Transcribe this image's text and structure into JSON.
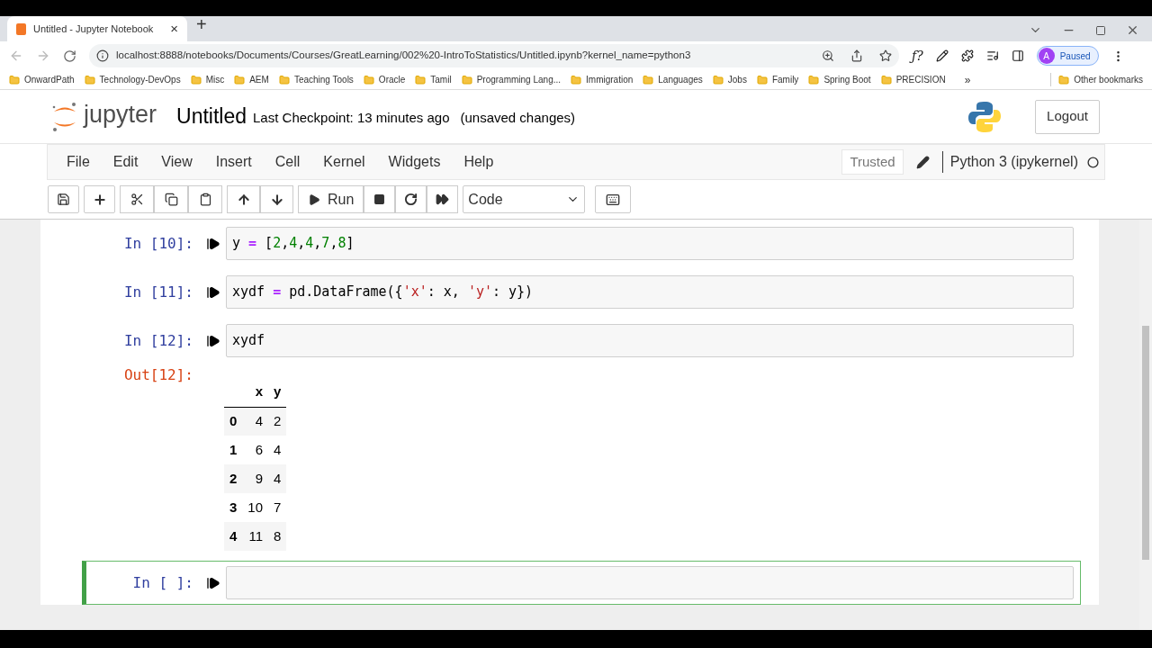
{
  "browser": {
    "tab": {
      "title": "Untitled - Jupyter Notebook",
      "close": "×",
      "new_tab": "+"
    },
    "address": "localhost:8888/notebooks/Documents/Courses/GreatLearning/002%20-IntroToStatistics/Untitled.ipynb?kernel_name=python3",
    "extension_label": "ƒ?",
    "profile": {
      "initial": "A",
      "status": "Paused"
    },
    "bookmarks": [
      "OnwardPath",
      "Technology-DevOps",
      "Misc",
      "AEM",
      "Teaching Tools",
      "Oracle",
      "Tamil",
      "Programming Lang...",
      "Immigration",
      "Languages",
      "Jobs",
      "Family",
      "Spring Boot",
      "PRECISION"
    ],
    "overflow": "»",
    "other_bookmarks": "Other bookmarks"
  },
  "header": {
    "logo_text": "jupyter",
    "notebook_name": "Untitled",
    "checkpoint": "Last Checkpoint: 13 minutes ago",
    "save_status": "(unsaved changes)",
    "logout": "Logout"
  },
  "menu": [
    "File",
    "Edit",
    "View",
    "Insert",
    "Cell",
    "Kernel",
    "Widgets",
    "Help"
  ],
  "trusted": "Trusted",
  "kernel": "Python 3 (ipykernel)",
  "toolbar": {
    "run": "Run",
    "cell_type": "Code"
  },
  "cells": [
    {
      "prompt": "In [10]:",
      "selected": false,
      "code": [
        {
          "kind": "plain",
          "text": "y "
        },
        {
          "kind": "op",
          "text": "="
        },
        {
          "kind": "plain",
          "text": " ["
        },
        {
          "kind": "number",
          "text": "2"
        },
        {
          "kind": "plain",
          "text": ","
        },
        {
          "kind": "number",
          "text": "4"
        },
        {
          "kind": "plain",
          "text": ","
        },
        {
          "kind": "number",
          "text": "4"
        },
        {
          "kind": "plain",
          "text": ","
        },
        {
          "kind": "number",
          "text": "7"
        },
        {
          "kind": "plain",
          "text": ","
        },
        {
          "kind": "number",
          "text": "8"
        },
        {
          "kind": "plain",
          "text": "]"
        }
      ]
    },
    {
      "prompt": "In [11]:",
      "selected": false,
      "code": [
        {
          "kind": "plain",
          "text": "xydf "
        },
        {
          "kind": "op",
          "text": "="
        },
        {
          "kind": "plain",
          "text": " pd.DataFrame({"
        },
        {
          "kind": "string",
          "text": "'x'"
        },
        {
          "kind": "plain",
          "text": ": x, "
        },
        {
          "kind": "string",
          "text": "'y'"
        },
        {
          "kind": "plain",
          "text": ": y})"
        }
      ]
    },
    {
      "prompt": "In [12]:",
      "selected": false,
      "code": [
        {
          "kind": "plain",
          "text": "xydf"
        }
      ],
      "output": {
        "prompt": "Out[12]:",
        "columns": [
          "",
          "x",
          "y"
        ],
        "rows": [
          [
            "0",
            "4",
            "2"
          ],
          [
            "1",
            "6",
            "4"
          ],
          [
            "2",
            "9",
            "4"
          ],
          [
            "3",
            "10",
            "7"
          ],
          [
            "4",
            "11",
            "8"
          ]
        ]
      }
    },
    {
      "prompt": "In [ ]:",
      "selected": true
    }
  ]
}
